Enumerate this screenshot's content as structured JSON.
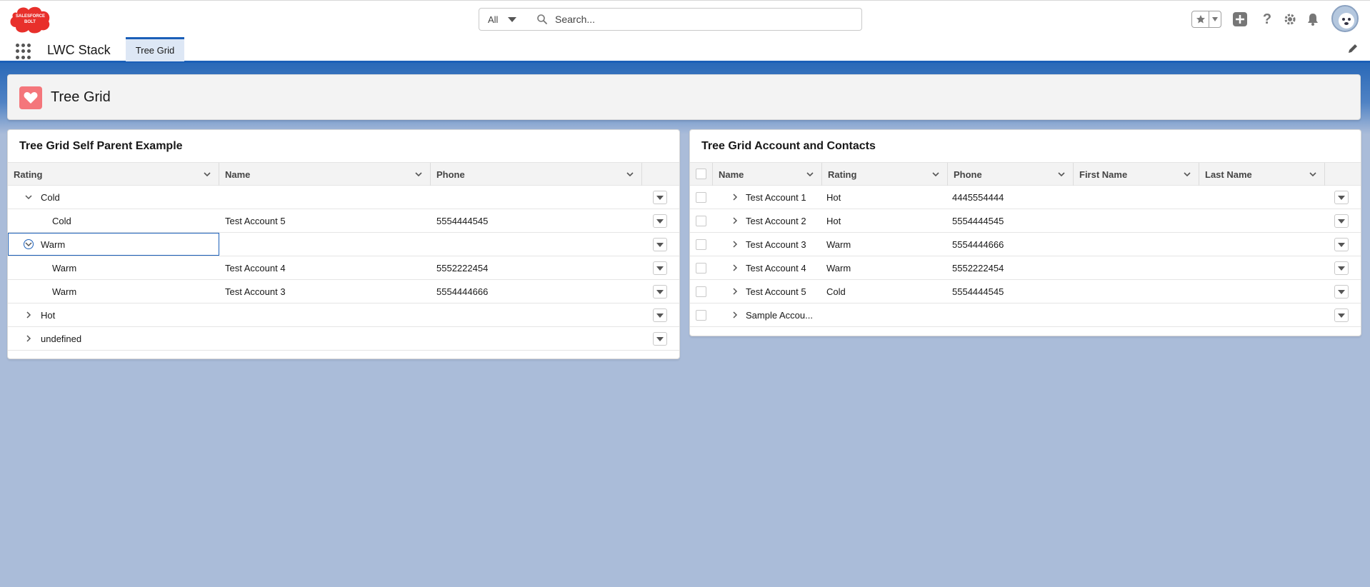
{
  "header": {
    "logo_text": "SALESFORCE BOLT",
    "search_scope": "All",
    "search_placeholder": "Search..."
  },
  "nav": {
    "app_name": "LWC Stack",
    "tabs": [
      {
        "label": "Tree Grid"
      }
    ]
  },
  "page_header": {
    "title": "Tree Grid",
    "icon": "heart-icon"
  },
  "left_card": {
    "title": "Tree Grid Self Parent Example",
    "columns": [
      "Rating",
      "Name",
      "Phone"
    ],
    "rows": [
      {
        "rating": "Cold",
        "name": "",
        "phone": "",
        "level": 1,
        "toggle": "expanded"
      },
      {
        "rating": "Cold",
        "name": "Test Account 5",
        "phone": "5554444545",
        "level": 2,
        "toggle": "none"
      },
      {
        "rating": "Warm",
        "name": "",
        "phone": "",
        "level": 1,
        "toggle": "expanded"
      },
      {
        "rating": "Warm",
        "name": "Test Account 4",
        "phone": "5552222454",
        "level": 2,
        "toggle": "none"
      },
      {
        "rating": "Warm",
        "name": "Test Account 3",
        "phone": "5554444666",
        "level": 2,
        "toggle": "none"
      },
      {
        "rating": "Hot",
        "name": "",
        "phone": "",
        "level": 1,
        "toggle": "collapsed"
      },
      {
        "rating": "undefined",
        "name": "",
        "phone": "",
        "level": 1,
        "toggle": "collapsed"
      }
    ]
  },
  "right_card": {
    "title": "Tree Grid Account and Contacts",
    "columns": [
      "Name",
      "Rating",
      "Phone",
      "First Name",
      "Last Name"
    ],
    "rows": [
      {
        "name": "Test Account 1",
        "rating": "Hot",
        "phone": "4445554444",
        "first_name": "",
        "last_name": ""
      },
      {
        "name": "Test Account 2",
        "rating": "Hot",
        "phone": "5554444545",
        "first_name": "",
        "last_name": ""
      },
      {
        "name": "Test Account 3",
        "rating": "Warm",
        "phone": "5554444666",
        "first_name": "",
        "last_name": ""
      },
      {
        "name": "Test Account 4",
        "rating": "Warm",
        "phone": "5552222454",
        "first_name": "",
        "last_name": ""
      },
      {
        "name": "Test Account 5",
        "rating": "Cold",
        "phone": "5554444545",
        "first_name": "",
        "last_name": ""
      },
      {
        "name": "Sample Accou...",
        "rating": "",
        "phone": "",
        "first_name": "",
        "last_name": ""
      }
    ]
  },
  "colors": {
    "brand_blue": "#1b5fb8",
    "page_bg": "#aabcd9",
    "heart_icon_bg": "#f4767b",
    "logo_red": "#e8302b"
  }
}
